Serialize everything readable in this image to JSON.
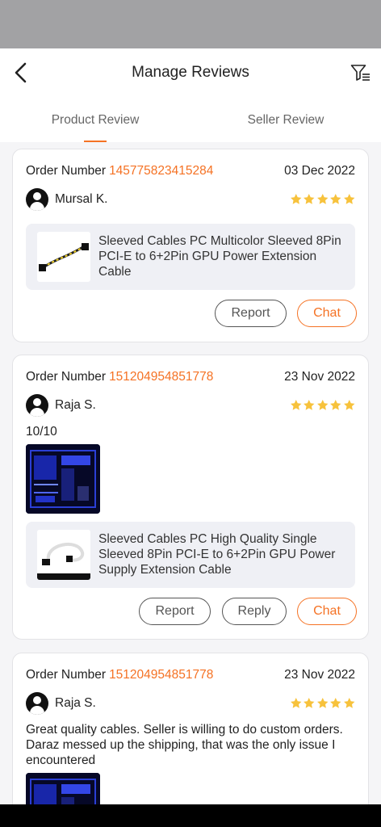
{
  "header": {
    "title": "Manage Reviews",
    "back_icon": "chevron-left-icon",
    "filter_icon": "filter-icon"
  },
  "tabs": [
    {
      "label": "Product Review",
      "active": true
    },
    {
      "label": "Seller Review",
      "active": false
    }
  ],
  "colors": {
    "accent": "#f57224",
    "star": "#f7c23c",
    "background": "#f5f5f7"
  },
  "reviews": [
    {
      "order_label": "Order Number",
      "order_number": "145775823415284",
      "date": "03 Dec 2022",
      "user": "Mursal K.",
      "rating": 5,
      "product_title": "Sleeved Cables PC Multicolor Sleeved 8Pin PCI-E to 6+2Pin GPU Power Extension Cable",
      "buttons": {
        "report": "Report",
        "chat": "Chat"
      }
    },
    {
      "order_label": "Order Number",
      "order_number": "151204954851778",
      "date": "23 Nov 2022",
      "user": "Raja S.",
      "rating": 5,
      "text": "10/10",
      "product_title": "Sleeved Cables PC High Quality Single Sleeved 8Pin PCI-E to 6+2Pin GPU Power Supply Extension Cable",
      "buttons": {
        "report": "Report",
        "reply": "Reply",
        "chat": "Chat"
      }
    },
    {
      "order_label": "Order Number",
      "order_number": "151204954851778",
      "date": "23 Nov 2022",
      "user": "Raja S.",
      "rating": 5,
      "text": "Great quality cables. Seller is willing to do custom orders. Daraz messed up the shipping, that was the only issue I encountered"
    }
  ]
}
